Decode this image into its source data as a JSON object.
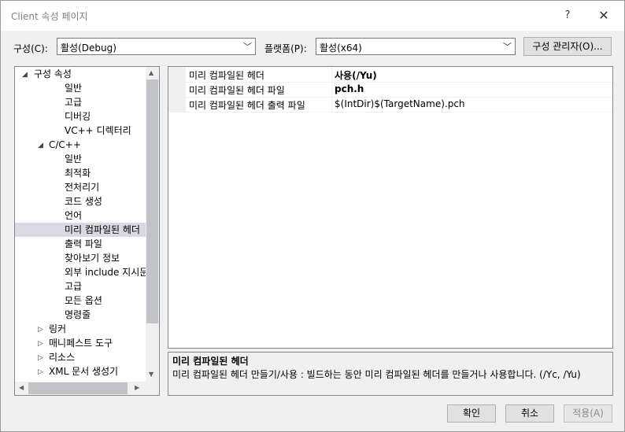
{
  "window": {
    "title": "Client 속성 페이지",
    "help": "?",
    "close": "✕"
  },
  "config": {
    "label": "구성(C):",
    "value": "활성(Debug)",
    "platform_label": "플랫폼(P):",
    "platform_value": "활성(x64)",
    "manager_button": "구성 관리자(O)..."
  },
  "tree": {
    "items": [
      {
        "label": "구성 속성",
        "expander": "◢"
      },
      {
        "label": "일반"
      },
      {
        "label": "고급"
      },
      {
        "label": "디버깅"
      },
      {
        "label": "VC++ 디렉터리"
      },
      {
        "label": "C/C++",
        "expander": "◢"
      },
      {
        "label": "일반"
      },
      {
        "label": "최적화"
      },
      {
        "label": "전처리기"
      },
      {
        "label": "코드 생성"
      },
      {
        "label": "언어"
      },
      {
        "label": "미리 컴파일된 헤더",
        "selected": true
      },
      {
        "label": "출력 파일"
      },
      {
        "label": "찾아보기 정보"
      },
      {
        "label": "외부 include 지시문"
      },
      {
        "label": "고급"
      },
      {
        "label": "모든 옵션"
      },
      {
        "label": "명령줄"
      },
      {
        "label": "링커",
        "expander": "▷"
      },
      {
        "label": "매니페스트 도구",
        "expander": "▷"
      },
      {
        "label": "리소스",
        "expander": "▷"
      },
      {
        "label": "XML 문서 생성기",
        "expander": "▷"
      }
    ]
  },
  "grid": {
    "rows": [
      {
        "name": "미리 컴파일된 헤더",
        "value": "사용(/Yu)"
      },
      {
        "name": "미리 컴파일된 헤더 파일",
        "value": "pch.h"
      },
      {
        "name": "미리 컴파일된 헤더 출력 파일",
        "value": "$(IntDir)$(TargetName).pch"
      }
    ]
  },
  "description": {
    "title": "미리 컴파일된 헤더",
    "text": "미리 컴파일된 헤더 만들기/사용 : 빌드하는 동안 미리 컴파일된 헤더를 만들거나 사용합니다.     (/Yc, /Yu)"
  },
  "buttons": {
    "ok": "확인",
    "cancel": "취소",
    "apply": "적용(A)"
  }
}
